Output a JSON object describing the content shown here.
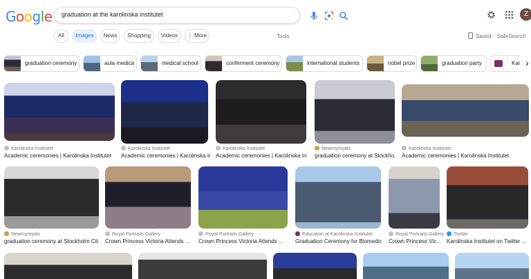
{
  "header": {
    "logo": "Google",
    "query": "graduation at the karolinska institutet",
    "avatar_letter": "Z"
  },
  "tabs": [
    {
      "label": "All"
    },
    {
      "label": "Images"
    },
    {
      "label": "News"
    },
    {
      "label": "Shopping"
    },
    {
      "label": "Videos"
    },
    {
      "label": "⋮ More"
    }
  ],
  "tools_label": "Tools",
  "saved_label": "Saved",
  "safesearch_label": "SafeSearch",
  "chips": [
    {
      "label": "graduation ceremony"
    },
    {
      "label": "aula medica"
    },
    {
      "label": "medical school"
    },
    {
      "label": "conferment ceremony"
    },
    {
      "label": "international students"
    },
    {
      "label": "nobel prize"
    },
    {
      "label": "graduation party"
    },
    {
      "label": "Karolinska Instit..."
    }
  ],
  "results": [
    {
      "source": "Karolinska Institutet",
      "title": "Academic ceremonies | Karolinska Institutet"
    },
    {
      "source": "Karolinska Institutet",
      "title": "Academic ceremonies | Karolinska Institutet"
    },
    {
      "source": "Karolinska Institutet",
      "title": "Academic ceremonies | Karolinska Institutet"
    },
    {
      "source": "Newmyroyals",
      "title": "graduation ceremony at Stockho..."
    },
    {
      "source": "Karolinska Institutet",
      "title": "Academic ceremonies | Karolinska Institutet"
    },
    {
      "source": "Newmyroyals",
      "title": "graduation ceremony at Stockholm Cit..."
    },
    {
      "source": "Royal Portraits Gallery",
      "title": "Crown Princess Victoria Attends ..."
    },
    {
      "source": "Royal Portraits Gallery",
      "title": "Crown Princess Victoria Attends ..."
    },
    {
      "source": "Education at Karolinska Institutet",
      "title": "Graduation Ceremony for Biomedic..."
    },
    {
      "source": "Royal Portraits Gallery",
      "title": "Crown Princess Vic..."
    },
    {
      "source": "Twitter",
      "title": "Karolinska Institutet on Twitter ..."
    }
  ],
  "colors": {
    "accent": "#1a73e8",
    "active_tab_bg": "#e8f0fe",
    "border": "#dadce0",
    "muted_text": "#70757a"
  },
  "icons": [
    "mic-icon",
    "lens-icon",
    "search-icon",
    "gear-icon",
    "apps-icon",
    "chevron-right-icon"
  ]
}
